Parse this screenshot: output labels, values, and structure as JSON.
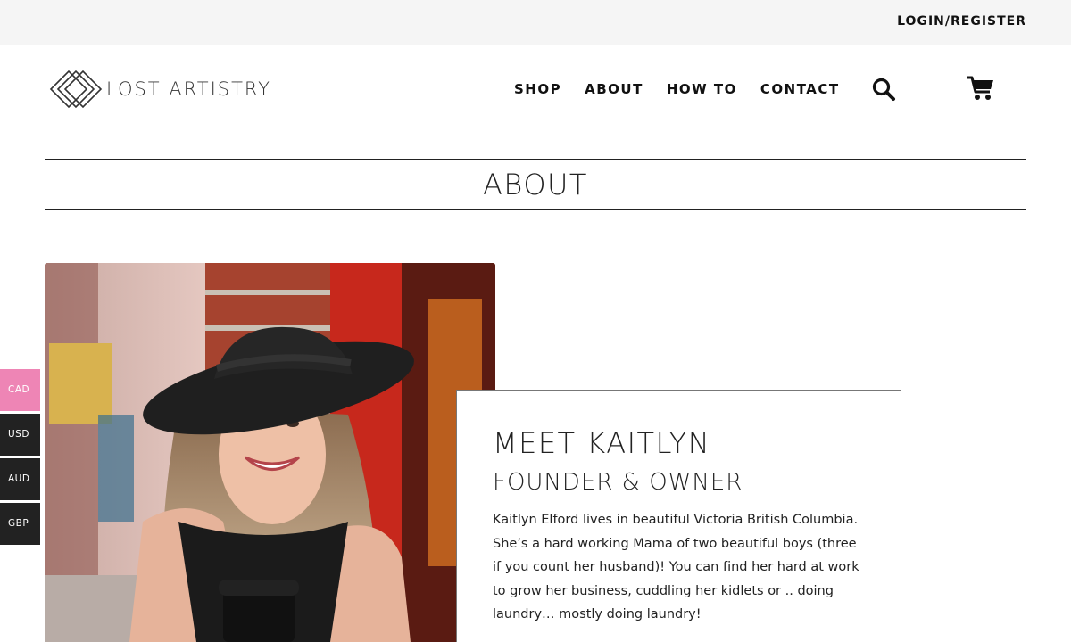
{
  "topbar": {
    "login_label": "LOGIN/REGISTER"
  },
  "brand": {
    "name": "LOST ARTISTRY",
    "icon": "diamond-logo-icon"
  },
  "nav": {
    "items": [
      {
        "label": "SHOP"
      },
      {
        "label": "ABOUT"
      },
      {
        "label": "HOW TO"
      },
      {
        "label": "CONTACT"
      }
    ],
    "search_icon": "search-icon",
    "cart_icon": "cart-icon"
  },
  "page": {
    "title": "ABOUT"
  },
  "about": {
    "heading": "MEET KAITLYN",
    "subheading": "FOUNDER & OWNER",
    "body": "Kaitlyn Elford lives in beautiful Victoria British Columbia. She’s a hard working Mama of two beautiful boys (three if you count her husband)! You can find her hard at work to grow her business, cuddling her kidlets or .. doing laundry… mostly doing laundry!"
  },
  "currencies": {
    "items": [
      {
        "code": "CAD",
        "active": true
      },
      {
        "code": "USD",
        "active": false
      },
      {
        "code": "AUD",
        "active": false
      },
      {
        "code": "GBP",
        "active": false
      }
    ],
    "active_color": "#ee85b5",
    "inactive_color": "#222222"
  }
}
